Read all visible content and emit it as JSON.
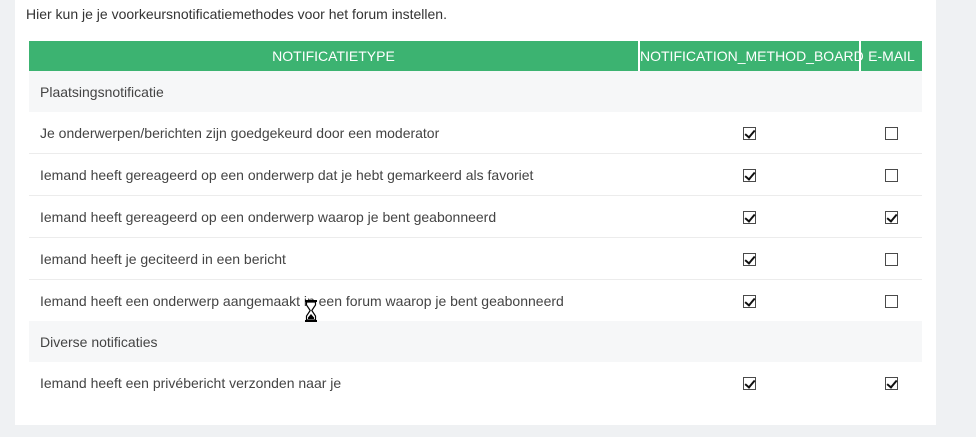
{
  "intro_text": "Hier kun je je voorkeursnotificatiemethodes voor het forum instellen.",
  "colors": {
    "header_bg": "#3cb371",
    "section_bg": "#f6f7f8",
    "page_bg": "#eff1f3"
  },
  "table": {
    "headers": {
      "type": "NOTIFICATIETYPE",
      "board": "NOTIFICATION_METHOD_BOARD",
      "email": "E-MAIL"
    },
    "sections": [
      {
        "title": "Plaatsingsnotificatie",
        "rows": [
          {
            "label": "Je onderwerpen/berichten zijn goedgekeurd door een moderator",
            "board": true,
            "email": false
          },
          {
            "label": "Iemand heeft gereageerd op een onderwerp dat je hebt gemarkeerd als favoriet",
            "board": true,
            "email": false
          },
          {
            "label": "Iemand heeft gereageerd op een onderwerp waarop je bent geabonneerd",
            "board": true,
            "email": true
          },
          {
            "label": "Iemand heeft je geciteerd in een bericht",
            "board": true,
            "email": false
          },
          {
            "label": "Iemand heeft een onderwerp aangemaakt in een forum waarop je bent geabonneerd",
            "board": true,
            "email": false
          }
        ]
      },
      {
        "title": "Diverse notificaties",
        "rows": [
          {
            "label": "Iemand heeft een privébericht verzonden naar je",
            "board": true,
            "email": true
          }
        ]
      }
    ]
  },
  "cursor_icon": "hourglass-cursor-icon"
}
